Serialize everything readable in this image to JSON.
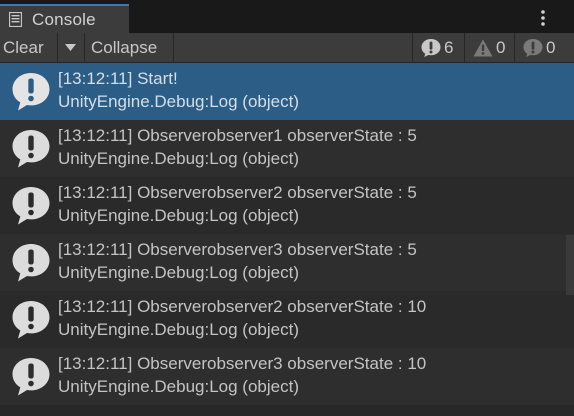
{
  "window": {
    "tab_label": "Console",
    "tab_icon": "console-list-icon",
    "menu_icon": "kebab-menu-icon"
  },
  "toolbar": {
    "clear_label": "Clear",
    "clear_dropdown_icon": "caret-down-icon",
    "collapse_label": "Collapse",
    "counters": {
      "info": {
        "icon": "info-exclamation-icon",
        "count": "6"
      },
      "warning": {
        "icon": "warning-triangle-icon",
        "count": "0"
      },
      "error": {
        "icon": "error-exclamation-icon",
        "count": "0"
      }
    }
  },
  "logs": [
    {
      "line1": "[13:12:11] Start!",
      "line2": "UnityEngine.Debug:Log (object)",
      "selected": true
    },
    {
      "line1": "[13:12:11] Observerobserver1 observerState : 5",
      "line2": "UnityEngine.Debug:Log (object)",
      "selected": false
    },
    {
      "line1": "[13:12:11] Observerobserver2 observerState : 5",
      "line2": "UnityEngine.Debug:Log (object)",
      "selected": false
    },
    {
      "line1": "[13:12:11] Observerobserver3 observerState : 5",
      "line2": "UnityEngine.Debug:Log (object)",
      "selected": false
    },
    {
      "line1": "[13:12:11] Observerobserver2 observerState : 10",
      "line2": "UnityEngine.Debug:Log (object)",
      "selected": false
    },
    {
      "line1": "[13:12:11] Observerobserver3 observerState : 10",
      "line2": "UnityEngine.Debug:Log (object)",
      "selected": false
    }
  ],
  "colors": {
    "selected_row": "#2c5d87",
    "tab_accent": "#3a79bb"
  }
}
